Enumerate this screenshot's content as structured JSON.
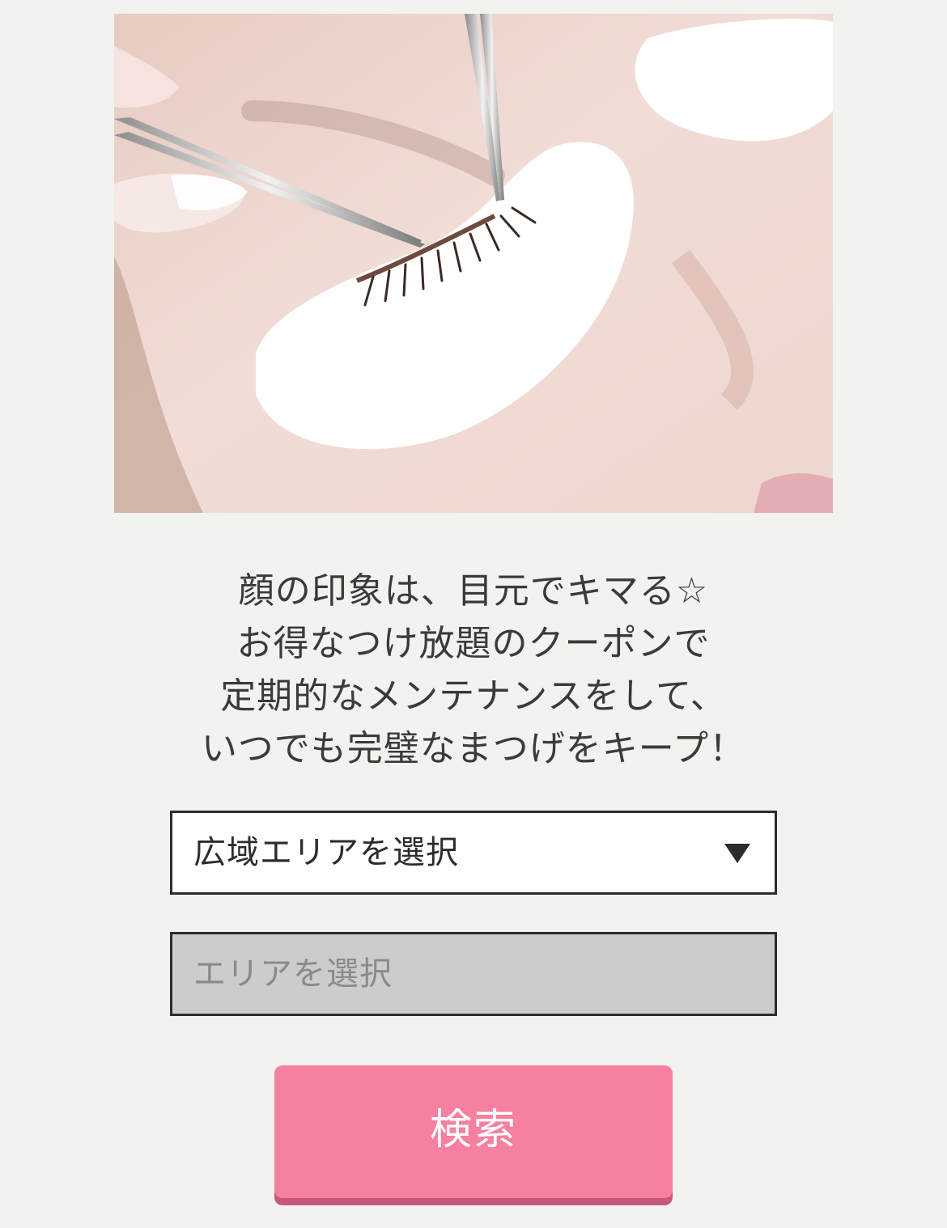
{
  "hero": {
    "image_description": "eyelash-extension-photo"
  },
  "lead": {
    "lines": [
      "顔の印象は、目元でキマる☆",
      "お得なつけ放題のクーポンで",
      "定期的なメンテナンスをして、",
      "いつでも完璧なまつげをキープ！"
    ]
  },
  "form": {
    "prefecture_select_label": "広域エリアを選択",
    "area_select_label": "エリアを選択",
    "search_label": "検索"
  },
  "colors": {
    "background": "#f2f2ee",
    "button": "#f77f9f",
    "button_shadow": "#c6587a",
    "disabled_select": "#cccccc"
  }
}
